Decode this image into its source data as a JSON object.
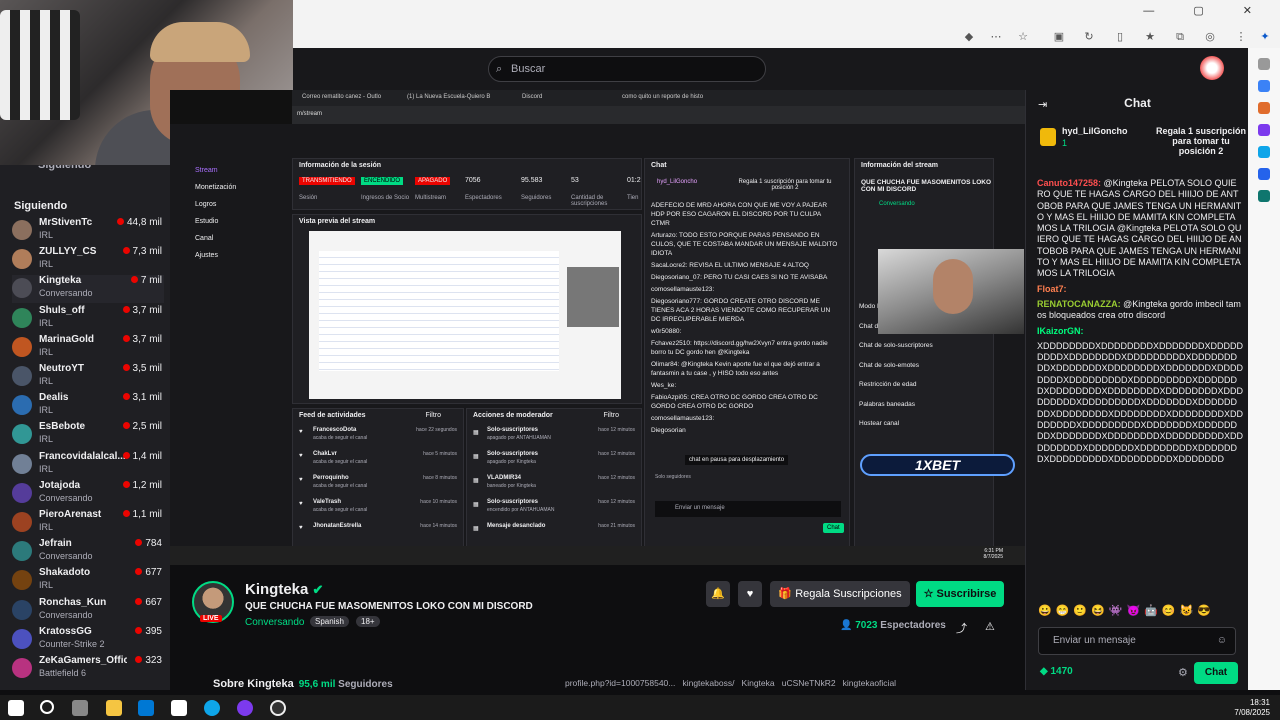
{
  "search": {
    "placeholder": "Buscar"
  },
  "sidebar": {
    "following_header": "Siguiendo",
    "following_header_top": "Siguiendo",
    "channels": [
      {
        "name": "MrStivenTc",
        "sub": "IRL",
        "viewers": "44,8 mil"
      },
      {
        "name": "ZULLYY_CS",
        "sub": "IRL",
        "viewers": "7,3 mil"
      },
      {
        "name": "Kingteka",
        "sub": "Conversando",
        "viewers": "7 mil"
      },
      {
        "name": "Shuls_off",
        "sub": "IRL",
        "viewers": "3,7 mil"
      },
      {
        "name": "MarinaGold",
        "sub": "IRL",
        "viewers": "3,7 mil"
      },
      {
        "name": "NeutroYT",
        "sub": "IRL",
        "viewers": "3,5 mil"
      },
      {
        "name": "Dealis",
        "sub": "IRL",
        "viewers": "3,1 mil"
      },
      {
        "name": "EsBebote",
        "sub": "IRL",
        "viewers": "2,5 mil"
      },
      {
        "name": "Francovidalalcal...",
        "sub": "IRL",
        "viewers": "1,4 mil"
      },
      {
        "name": "Jotajoda",
        "sub": "Conversando",
        "viewers": "1,2 mil"
      },
      {
        "name": "PieroArenast",
        "sub": "IRL",
        "viewers": "1,1 mil"
      },
      {
        "name": "Jefrain",
        "sub": "Conversando",
        "viewers": "784"
      },
      {
        "name": "Shakadoto",
        "sub": "IRL",
        "viewers": "677"
      },
      {
        "name": "Ronchas_Kun",
        "sub": "Conversando",
        "viewers": "667"
      },
      {
        "name": "KratossGG",
        "sub": "Counter-Strike 2",
        "viewers": "395"
      },
      {
        "name": "ZeKaGamers_Official",
        "sub": "Battlefield 6",
        "viewers": "323"
      }
    ]
  },
  "stream": {
    "dash_menu": [
      "Stream",
      "Monetización",
      "Logros",
      "Estudio",
      "Canal",
      "Ajustes"
    ],
    "inner_tabs": [
      "Correo rematito canez - Outlo",
      "(1) La Nueva Escuela-Quiero B",
      "Discord",
      "como quito un reporte de histo"
    ],
    "inner_url": "m/stream",
    "session_title": "Información de la sesión",
    "session_badges": [
      "TRANSMITIENDO",
      "ENCENDIDO",
      "APAGADO"
    ],
    "session_labels": [
      "Sesión",
      "Ingresos de Socio",
      "Multistream"
    ],
    "session_stats": [
      {
        "value": "7056",
        "label": "Espectadores"
      },
      {
        "value": "95.583",
        "label": "Seguidores"
      },
      {
        "value": "53",
        "label": "Cantidad de suscripciones"
      },
      {
        "value": "01:2",
        "label": "Tien"
      }
    ],
    "preview_title": "Vista previa del stream",
    "feed_title": "Feed de actividades",
    "feed_filter": "Filtro",
    "feed": [
      {
        "name": "FrancescoDota",
        "action": "acaba de seguir el canal",
        "time": "hace 22 segundos"
      },
      {
        "name": "ChakLvr",
        "action": "acaba de seguir el canal",
        "time": "hace 5 minutos"
      },
      {
        "name": "Perroquinho",
        "action": "acaba de seguir el canal",
        "time": "hace 8 minutos"
      },
      {
        "name": "ValeTrash",
        "action": "acaba de seguir el canal",
        "time": "hace 10 minutos"
      },
      {
        "name": "JhonatanEstrella",
        "action": "",
        "time": "hace 14 minutos"
      }
    ],
    "mod_title": "Acciones de moderador",
    "mod_filter": "Filtro",
    "mod": [
      {
        "name": "Solo-suscriptores",
        "action": "apagado por ANTAHUAMAN",
        "time": "hace 12 minutos"
      },
      {
        "name": "Solo-suscriptores",
        "action": "apagado por Kingteka",
        "time": "hace 12 minutos"
      },
      {
        "name": "VLADMIR34",
        "action": "baneado por Kingteka",
        "time": "hace 12 minutos"
      },
      {
        "name": "Solo-suscriptores",
        "action": "encendido por ANTAHUAMAN",
        "time": "hace 12 minutos"
      },
      {
        "name": "Mensaje desanclado",
        "action": "",
        "time": "hace 21 minutos"
      }
    ],
    "inner_chat_title": "Chat",
    "inner_chat_pinned_user": "hyd_LilGoncho",
    "inner_chat_pinned_text": "Regala 1 suscripción para tomar tu posición 2",
    "inner_chat": [
      "ADEFECIO DE MRD AHORA CON QUE ME VOY A PAJEAR HDP POR ESO CAGARON EL DISCORD POR TU CULPA CTMR",
      "Arturazo: TODO ESTO PORQUE PARAS PENSANDO EN CULOS, QUE TE COSTABA MANDAR UN MENSAJE MALDITO IDIOTA",
      "SacaLocre2: REVISA EL ULTIMO MENSAJE 4 ALTOQ",
      "Diegosoriano_07: PERO TU CASI CAES SI NO TE AVISABA",
      "comosellamauste123:",
      "Diegosoriano777: GORDO CREATE OTRO DISCORD ME TIENES ACA 2 HORAS VIENDOTE COMO RECUPERAR UN DC IRRECUPERABLE MIERDA",
      "w0r50880:",
      "Fchavez2510: https://discord.gg/hw2Xvyn7 entra gordo nadie borro tu DC gordo hen @Kingteka",
      "Olimar84: @Kingteka Kevin aporte fue el que dejó entrar a fantasmin a tu case , y HISO todo eso antes",
      "Wes_ke:",
      "FabioAzpi05: CREA OTRO DC GORDO CREA OTRO DC GORDO CREA OTRO DC GORDO",
      "comosellamauste123:",
      "Diegosorian"
    ],
    "inner_chat_paused": "chat en pausa para desplazamiento",
    "inner_chat_input": "Enviar un mensaje",
    "inner_chat_subs": "Solo seguidores",
    "inner_chat_button": "Chat",
    "stream_info_title": "Información del stream",
    "stream_info_text": "QUE CHUCHA FUE MASOMENITOS LOKO CON MI DISCORD",
    "stream_info_cat": "Conversando",
    "mod_settings": [
      "Modo lento",
      "Chat de solo-seguidores",
      "Chat de solo-suscriptores",
      "Chat de solo-emotes",
      "Restricción de edad",
      "Palabras baneadas",
      "Hostear canal"
    ],
    "sponsor": "1XBET"
  },
  "channel": {
    "name": "Kingteka",
    "live": "LIVE",
    "title": "QUE CHUCHA FUE MASOMENITOS LOKO CON MI DISCORD",
    "category": "Conversando",
    "tags": [
      "Spanish",
      "18+"
    ],
    "gift_label": "Regala Suscripciones",
    "subscribe_label": "Suscribirse",
    "viewers": "7023",
    "viewers_label": "Espectadores",
    "about": "Sobre Kingteka",
    "followers": "95,6 mil",
    "followers_label": "Seguidores",
    "socials": [
      "profile.php?id=1000758540...",
      "kingtekaboss/",
      "Kingteka",
      "uCSNeTNkR2",
      "kingtekaoficial"
    ]
  },
  "chat": {
    "title": "Chat",
    "pinned_user": "hyd_LilGoncho",
    "pinned_count": "1",
    "pinned_text": "Regala 1 suscripción para tomar tu posición 2",
    "messages": [
      {
        "user": "Canuto147258:",
        "cls": "u1",
        "text": " @Kingteka PELOTA SOLO QUIERO QUE TE HAGAS CARGO DEL HIIIJO DE ANTOBOB PARA QUE JAMES TENGA UN HERMANITO Y MAS EL HIIIJO DE MAMITA KIN COMPLETAMOS LA TRILOGIA @Kingteka PELOTA SOLO QUIERO QUE TE HAGAS CARGO DEL HIIIJO DE ANTOBOB PARA QUE JAMES TENGA UN HERMANITO Y MAS EL HIIIJO DE MAMITA KIN COMPLETAMOS LA TRILOGIA"
      },
      {
        "user": "Float7:",
        "cls": "u2",
        "text": ""
      },
      {
        "user": "RENATOCANAZZA:",
        "cls": "u4",
        "text": " @Kingteka gordo imbecil tamos bloqueados crea otro discord"
      },
      {
        "user": "IKaizorGN:",
        "cls": "u3",
        "text": ""
      },
      {
        "user": "",
        "cls": "",
        "text": "XDDDDDDDDXDDDDDDDDXDDDDDDDXDDDDDDDDDXDDDDDDDDXDDDDDDDDDXDDDDDDDDDXDDDDDDDXDDDDDDDDXDDDDDDDXDDDDDDDDXDDDDDDDDDXDDDDDDDDDXDDDDDDDXDDDDDDDDXDDDDDDDDXDDDDDDDDXDDDDDDDDDXDDDDDDDDDXDDDDDDDXDDDDDDDDXDDDDDDDDXDDDDDDDDXDDDDDDDDXDDDDDDDDXDDDDDDDDDXDDDDDDDXDDDDDDDDXDDDDDDDXDDDDDDDDXDDDDDDDDDXDDDDDDDDDXDDDDDDDXDDDDDDDDXDDDDDDDXDDDDDDDDDXDDDDDDDDDXDDDDDDD"
      }
    ],
    "input_placeholder": "Enviar un mensaje",
    "points": "1470",
    "send_label": "Chat"
  },
  "clock": {
    "time": "18:31",
    "date": "7/08/2025"
  },
  "inner_clock": {
    "time": "6:31 PM",
    "date": "8/7/2025"
  }
}
